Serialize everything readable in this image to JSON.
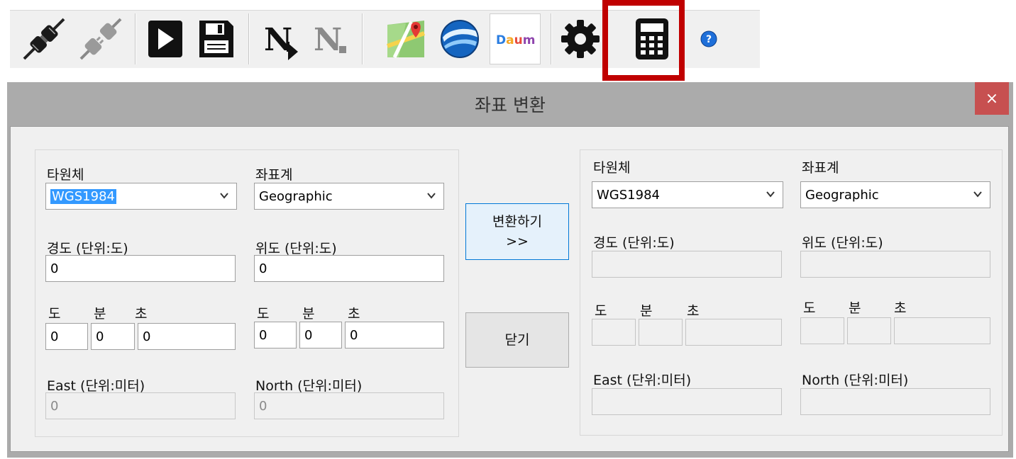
{
  "toolbar": {
    "icons": [
      "connect-plug-icon",
      "disconnect-plug-icon",
      "play-icon",
      "save-icon",
      "n-arrow-icon",
      "n-disabled-icon",
      "google-maps-icon",
      "google-earth-icon",
      "daum-map-icon",
      "settings-gear-icon",
      "calculator-icon",
      "help-icon"
    ],
    "daum_label": "Daum"
  },
  "dialog": {
    "title": "좌표 변환",
    "close_label": "×",
    "convert_button": [
      "변환하기",
      ">>"
    ],
    "close_button": "닫기",
    "left": {
      "ellipsoid_label": "타원체",
      "ellipsoid_value": "WGS1984",
      "crs_label": "좌표계",
      "crs_value": "Geographic",
      "lon_label": "경도 (단위:도)",
      "lon_value": "0",
      "lat_label": "위도 (단위:도)",
      "lat_value": "0",
      "deg_label": "도",
      "min_label": "분",
      "sec_label": "초",
      "lon_dms": [
        "0",
        "0",
        "0"
      ],
      "lat_dms": [
        "0",
        "0",
        "0"
      ],
      "east_label": "East (단위:미터)",
      "east_value": "0",
      "north_label": "North (단위:미터)",
      "north_value": "0"
    },
    "right": {
      "ellipsoid_label": "타원체",
      "ellipsoid_value": "WGS1984",
      "crs_label": "좌표계",
      "crs_value": "Geographic",
      "lon_label": "경도 (단위:도)",
      "lat_label": "위도 (단위:도)",
      "deg_label": "도",
      "min_label": "분",
      "sec_label": "초",
      "east_label": "East (단위:미터)",
      "north_label": "North (단위:미터)"
    }
  }
}
